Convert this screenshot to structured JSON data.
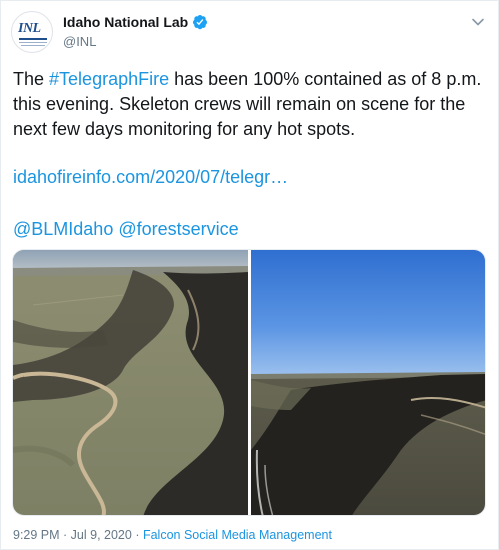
{
  "author": {
    "display_name": "Idaho National Lab",
    "handle": "@INL",
    "avatar_text": "INL",
    "verified": true
  },
  "tweet": {
    "text_before": "The ",
    "hashtag": "#TelegraphFire",
    "text_after": " has been 100% contained as of 8 p.m. this evening. Skeleton crews will remain on scene for the next few days monitoring for any hot spots.",
    "link": "idahofireinfo.com/2020/07/telegr…",
    "mention_1": "@BLMIdaho",
    "mention_2": "@forestservice"
  },
  "footer": {
    "time": "9:29 PM",
    "separator_1": " · ",
    "date": "Jul 9, 2020",
    "separator_2": " · ",
    "source": "Falcon Social Media Management"
  },
  "colors": {
    "link": "#1b95e0",
    "text": "#14171a",
    "muted": "#657786",
    "verified": "#1da1f2"
  },
  "icons": {
    "verified": "verified-badge-icon",
    "menu": "chevron-down-icon"
  }
}
